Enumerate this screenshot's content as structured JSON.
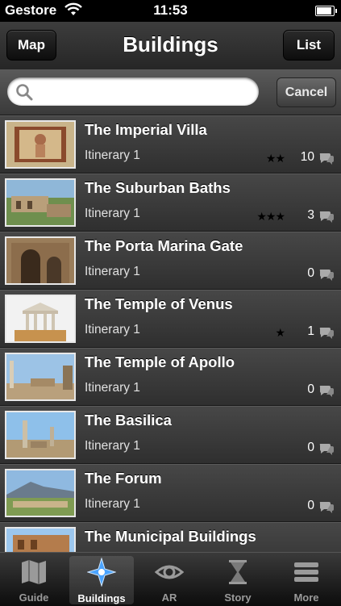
{
  "status_bar": {
    "carrier": "Gestore",
    "time": "11:53"
  },
  "navbar": {
    "title": "Buildings",
    "left_button": "Map",
    "right_button": "List"
  },
  "search": {
    "placeholder": "",
    "value": "",
    "cancel_label": "Cancel"
  },
  "buildings": [
    {
      "title": "The Imperial Villa",
      "itinerary": "Itinerary 1",
      "stars": "★★",
      "comments": "10"
    },
    {
      "title": "The Suburban Baths",
      "itinerary": "Itinerary 1",
      "stars": "★★★",
      "comments": "3"
    },
    {
      "title": "The Porta Marina Gate",
      "itinerary": "Itinerary 1",
      "stars": "",
      "comments": "0"
    },
    {
      "title": "The Temple of Venus",
      "itinerary": "Itinerary 1",
      "stars": "★",
      "comments": "1"
    },
    {
      "title": "The Temple of Apollo",
      "itinerary": "Itinerary 1",
      "stars": "",
      "comments": "0"
    },
    {
      "title": "The Basilica",
      "itinerary": "Itinerary 1",
      "stars": "",
      "comments": "0"
    },
    {
      "title": "The Forum",
      "itinerary": "Itinerary 1",
      "stars": "",
      "comments": "0"
    },
    {
      "title": "The Municipal Buildings",
      "itinerary": "",
      "stars": "",
      "comments": ""
    }
  ],
  "tabs": [
    {
      "label": "Guide",
      "icon": "map-icon"
    },
    {
      "label": "Buildings",
      "icon": "compass-star-icon",
      "active": true
    },
    {
      "label": "AR",
      "icon": "eye-icon"
    },
    {
      "label": "Story",
      "icon": "hourglass-icon"
    },
    {
      "label": "More",
      "icon": "menu-lines-icon"
    }
  ],
  "colors": {
    "active_tab_icon": "#4aa3ff",
    "star": "#000000"
  }
}
